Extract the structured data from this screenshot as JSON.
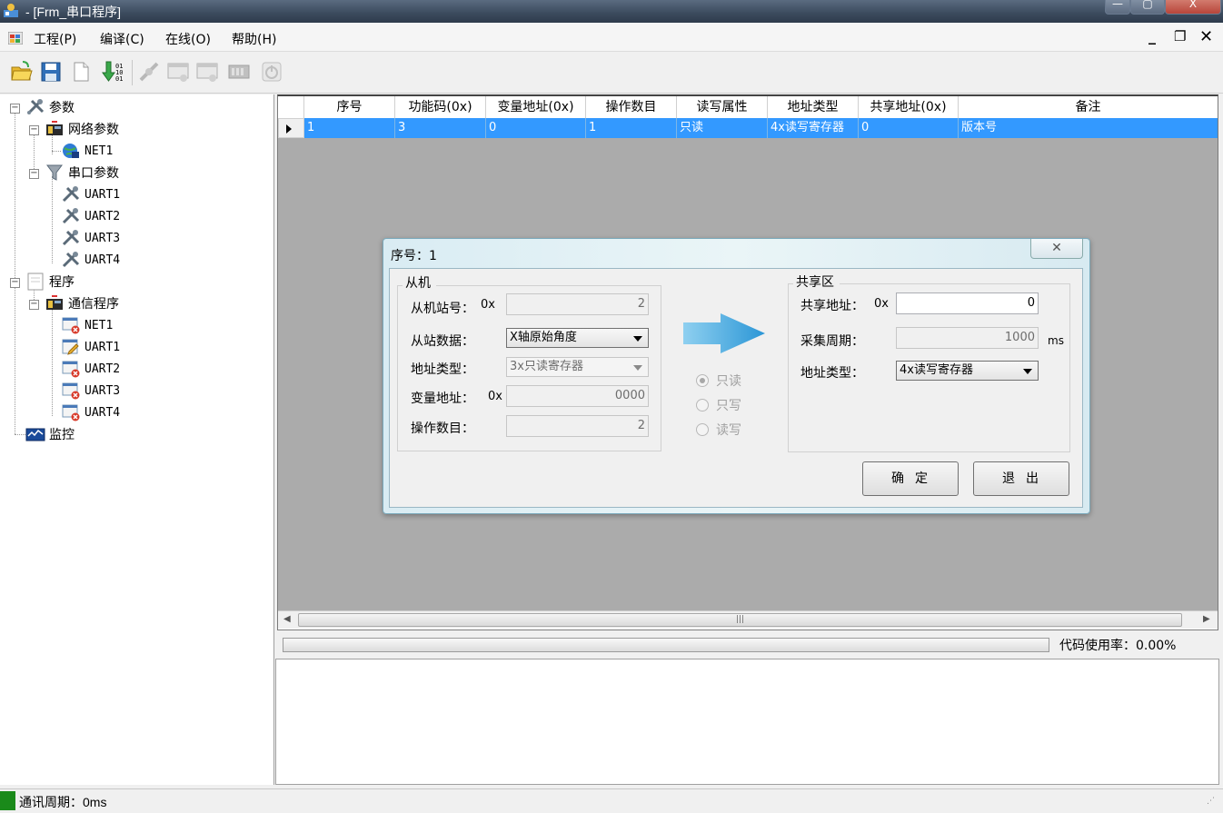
{
  "window": {
    "title": "- [Frm_串口程序]"
  },
  "menu": {
    "items": [
      "工程(P)",
      "编译(C)",
      "在线(O)",
      "帮助(H)"
    ]
  },
  "tree": {
    "nodes": [
      {
        "label": "参数",
        "icon": "tools-icon"
      },
      {
        "label": "网络参数",
        "icon": "network-card-icon"
      },
      {
        "label": "NET1",
        "icon": "globe-icon"
      },
      {
        "label": "串口参数",
        "icon": "funnel-icon"
      },
      {
        "label": "UART1",
        "icon": "tools-icon"
      },
      {
        "label": "UART2",
        "icon": "tools-icon"
      },
      {
        "label": "UART3",
        "icon": "tools-icon"
      },
      {
        "label": "UART4",
        "icon": "tools-icon"
      },
      {
        "label": "程序",
        "icon": "document-icon"
      },
      {
        "label": "通信程序",
        "icon": "network-card-icon"
      },
      {
        "label": "NET1",
        "icon": "program-error-icon"
      },
      {
        "label": "UART1",
        "icon": "program-edit-icon"
      },
      {
        "label": "UART2",
        "icon": "program-error-icon"
      },
      {
        "label": "UART3",
        "icon": "program-error-icon"
      },
      {
        "label": "UART4",
        "icon": "program-error-icon"
      },
      {
        "label": "监控",
        "icon": "monitor-icon"
      }
    ]
  },
  "grid": {
    "headers": [
      "序号",
      "功能码(0x)",
      "变量地址(0x)",
      "操作数目",
      "读写属性",
      "地址类型",
      "共享地址(0x)",
      "备注"
    ],
    "rows": [
      [
        "1",
        "3",
        "0",
        "1",
        "只读",
        "4x读写寄存器",
        "0",
        "版本号"
      ]
    ]
  },
  "progress": {
    "label": "代码使用率：0.00%",
    "value": 0.0
  },
  "status": {
    "text": "通讯周期：0ms",
    "indicator_color": "#1a8a1a"
  },
  "dialog": {
    "title": "序号：1",
    "slave": {
      "group_label": "从机",
      "station_label": "从机站号：",
      "station_prefix": "0x",
      "station_value": "2",
      "data_label": "从站数据：",
      "data_value": "X轴原始角度",
      "addr_type_label": "地址类型：",
      "addr_type_value": "3x只读寄存器",
      "var_addr_label": "变量地址：",
      "var_addr_prefix": "0x",
      "var_addr_value": "0000",
      "count_label": "操作数目：",
      "count_value": "2"
    },
    "radios": [
      {
        "label": "只读",
        "checked": true
      },
      {
        "label": "只写",
        "checked": false
      },
      {
        "label": "读写",
        "checked": false
      }
    ],
    "shared": {
      "group_label": "共享区",
      "addr_label": "共享地址：",
      "addr_prefix": "0x",
      "addr_value": "0",
      "period_label": "采集周期：",
      "period_value": "1000",
      "period_unit": "ms",
      "type_label": "地址类型：",
      "type_value": "4x读写寄存器"
    },
    "ok_label": "确定",
    "exit_label": "退出"
  },
  "colors": {
    "selection": "#3399ff",
    "arrow": "#3ba4e0"
  }
}
